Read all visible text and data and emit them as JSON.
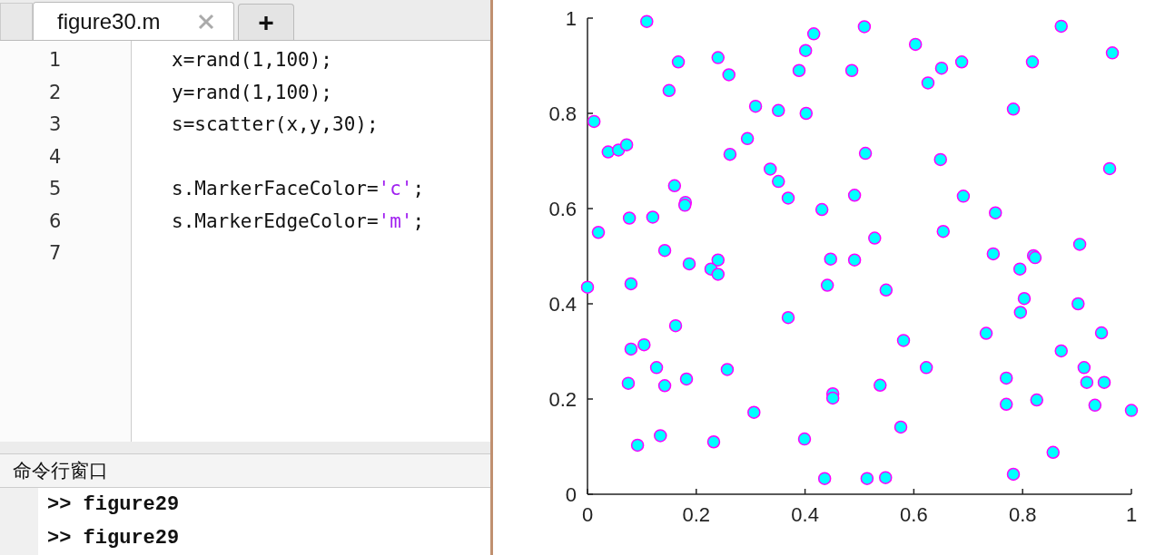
{
  "editor": {
    "tabs": [
      {
        "label": "figure30.m",
        "selected": true
      }
    ],
    "new_tab_label": "+",
    "lines": [
      {
        "number": "1",
        "segments": [
          {
            "kind": "code",
            "text": "x=rand(1,100);"
          }
        ]
      },
      {
        "number": "2",
        "segments": [
          {
            "kind": "code",
            "text": "y=rand(1,100);"
          }
        ]
      },
      {
        "number": "3",
        "segments": [
          {
            "kind": "code",
            "text": "s=scatter(x,y,30);"
          }
        ]
      },
      {
        "number": "4"
      },
      {
        "number": "5",
        "segments": [
          {
            "kind": "code",
            "text": "s.MarkerFaceColor="
          },
          {
            "kind": "string",
            "text": "'c'"
          },
          {
            "kind": "code",
            "text": ";"
          }
        ]
      },
      {
        "number": "6",
        "segments": [
          {
            "kind": "code",
            "text": "s.MarkerEdgeColor="
          },
          {
            "kind": "string",
            "text": "'m'"
          },
          {
            "kind": "code",
            "text": ";"
          }
        ]
      },
      {
        "number": "7"
      }
    ]
  },
  "command_window": {
    "title": "命令行窗口",
    "lines": [
      ">> figure29",
      ">> figure29"
    ]
  },
  "figure": {
    "chart_data": {
      "type": "scatter",
      "xlim": [
        0,
        1
      ],
      "ylim": [
        0,
        1
      ],
      "xticks": [
        0,
        0.2,
        0.4,
        0.6,
        0.8,
        1
      ],
      "yticks": [
        0,
        0.2,
        0.4,
        0.6,
        0.8,
        1
      ],
      "x": [
        0.109,
        0.012,
        0.038,
        0.057,
        0.072,
        0.167,
        0.15,
        0.24,
        0.26,
        0.416,
        0.401,
        0.389,
        0.509,
        0.603,
        0.651,
        0.626,
        0.688,
        0.486,
        0.871,
        0.965,
        0.818,
        0.309,
        0.351,
        0.402,
        0.783,
        0.294,
        0.262,
        0.336,
        0.351,
        0.369,
        0.511,
        0.649,
        0.491,
        0.431,
        0.16,
        0.18,
        0.179,
        0.077,
        0.12,
        0.02,
        0.691,
        0.75,
        0.96,
        0.654,
        0.528,
        0.142,
        0.187,
        0.227,
        0.24,
        0.24,
        0.447,
        0.491,
        0.746,
        0.82,
        0.823,
        0.795,
        0.905,
        0.0,
        0.08,
        0.441,
        0.549,
        0.803,
        0.796,
        0.902,
        0.369,
        0.162,
        0.581,
        0.733,
        0.945,
        0.08,
        0.104,
        0.871,
        0.127,
        0.257,
        0.623,
        0.913,
        0.142,
        0.182,
        0.075,
        0.77,
        0.918,
        0.95,
        0.451,
        0.451,
        0.538,
        0.77,
        0.826,
        0.933,
        1.0,
        0.306,
        0.134,
        0.092,
        0.232,
        0.399,
        0.576,
        0.856,
        0.436,
        0.514,
        0.548,
        0.783
      ],
      "series": [
        {
          "color": "#00ffff",
          "values": [
            0.993,
            0.783,
            0.719,
            0.723,
            0.734,
            0.908,
            0.848,
            0.917,
            0.881,
            0.967,
            0.932,
            0.89,
            0.982,
            0.945,
            0.895,
            0.864,
            0.908,
            0.89,
            0.983,
            0.927,
            0.908,
            0.815,
            0.806,
            0.8,
            0.809,
            0.747,
            0.714,
            0.683,
            0.657,
            0.622,
            0.716,
            0.703,
            0.628,
            0.598,
            0.648,
            0.613,
            0.607,
            0.58,
            0.582,
            0.55,
            0.626,
            0.591,
            0.684,
            0.552,
            0.538,
            0.512,
            0.484,
            0.473,
            0.492,
            0.462,
            0.494,
            0.492,
            0.505,
            0.501,
            0.497,
            0.473,
            0.525,
            0.435,
            0.442,
            0.439,
            0.429,
            0.411,
            0.382,
            0.4,
            0.371,
            0.354,
            0.323,
            0.338,
            0.339,
            0.305,
            0.314,
            0.301,
            0.266,
            0.262,
            0.266,
            0.266,
            0.228,
            0.242,
            0.233,
            0.244,
            0.235,
            0.235,
            0.211,
            0.202,
            0.229,
            0.189,
            0.198,
            0.187,
            0.176,
            0.172,
            0.123,
            0.103,
            0.11,
            0.116,
            0.141,
            0.088,
            0.033,
            0.033,
            0.035,
            0.042
          ]
        }
      ]
    }
  }
}
